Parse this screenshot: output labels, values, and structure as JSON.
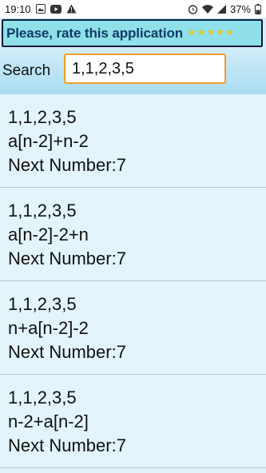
{
  "status_bar": {
    "time": "19:10",
    "battery": "37%",
    "left_icons": [
      "image-icon",
      "youtube-icon",
      "warning-icon"
    ],
    "right_icons": [
      "alarm-icon",
      "wifi-icon",
      "signal-icon",
      "battery-icon"
    ]
  },
  "banner": {
    "text": "Please, rate this application",
    "stars": 5,
    "star_color": "#f2c218"
  },
  "search": {
    "label": "Search",
    "value": "1,1,2,3,5"
  },
  "results": [
    {
      "sequence": "1,1,2,3,5",
      "formula": "a[n-2]+n-2",
      "next": "Next Number:7"
    },
    {
      "sequence": "1,1,2,3,5",
      "formula": "a[n-2]-2+n",
      "next": "Next Number:7"
    },
    {
      "sequence": "1,1,2,3,5",
      "formula": "n+a[n-2]-2",
      "next": "Next Number:7"
    },
    {
      "sequence": "1,1,2,3,5",
      "formula": "n-2+a[n-2]",
      "next": "Next Number:7"
    }
  ]
}
